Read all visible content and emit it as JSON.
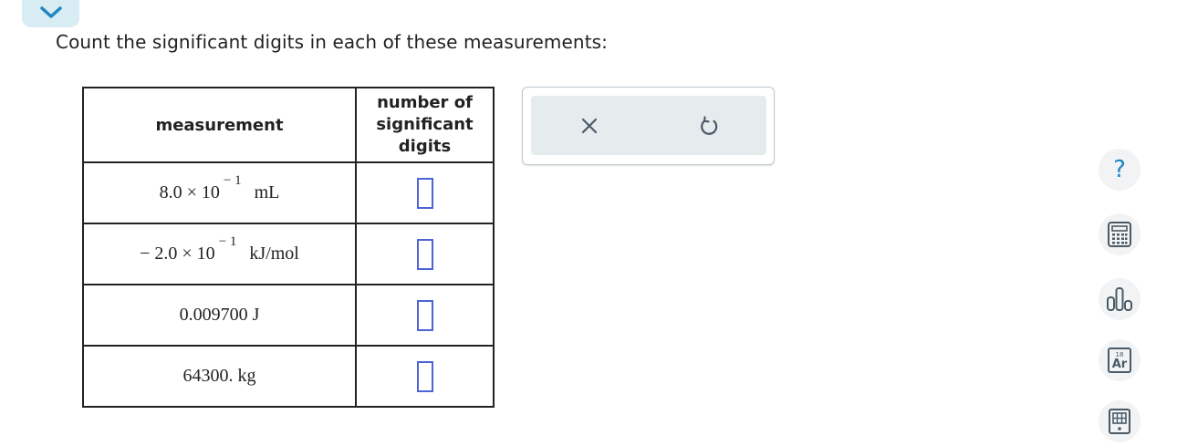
{
  "prompt": "Count the significant digits in each of these measurements:",
  "table": {
    "header_measurement": "measurement",
    "header_digits_line1": "number of",
    "header_digits_line2": "significant",
    "header_digits_line3": "digits",
    "rows": [
      {
        "prefix": "",
        "mantissa": "8.0 × 10",
        "exponent": "− 1",
        "unit": "mL",
        "answer": ""
      },
      {
        "prefix": "− ",
        "mantissa": "2.0 × 10",
        "exponent": "− 1",
        "unit": "kJ/mol",
        "answer": ""
      },
      {
        "value": "0.009700 J",
        "answer": ""
      },
      {
        "value": "64300. kg",
        "answer": ""
      }
    ]
  },
  "tools": {
    "clear_icon": "x-icon",
    "undo_icon": "undo-icon"
  },
  "sidebar": {
    "help_label": "?",
    "calculator_icon": "calculator-icon",
    "chart_icon": "bar-chart-icon",
    "periodic_number": "18",
    "periodic_symbol": "Ar",
    "reference_icon": "reference-book-icon"
  },
  "colors": {
    "accent": "#1f86c3",
    "input_border": "#4d63d6",
    "tab_bg": "#d8ecf3",
    "tool_bg": "#e6ebee"
  }
}
